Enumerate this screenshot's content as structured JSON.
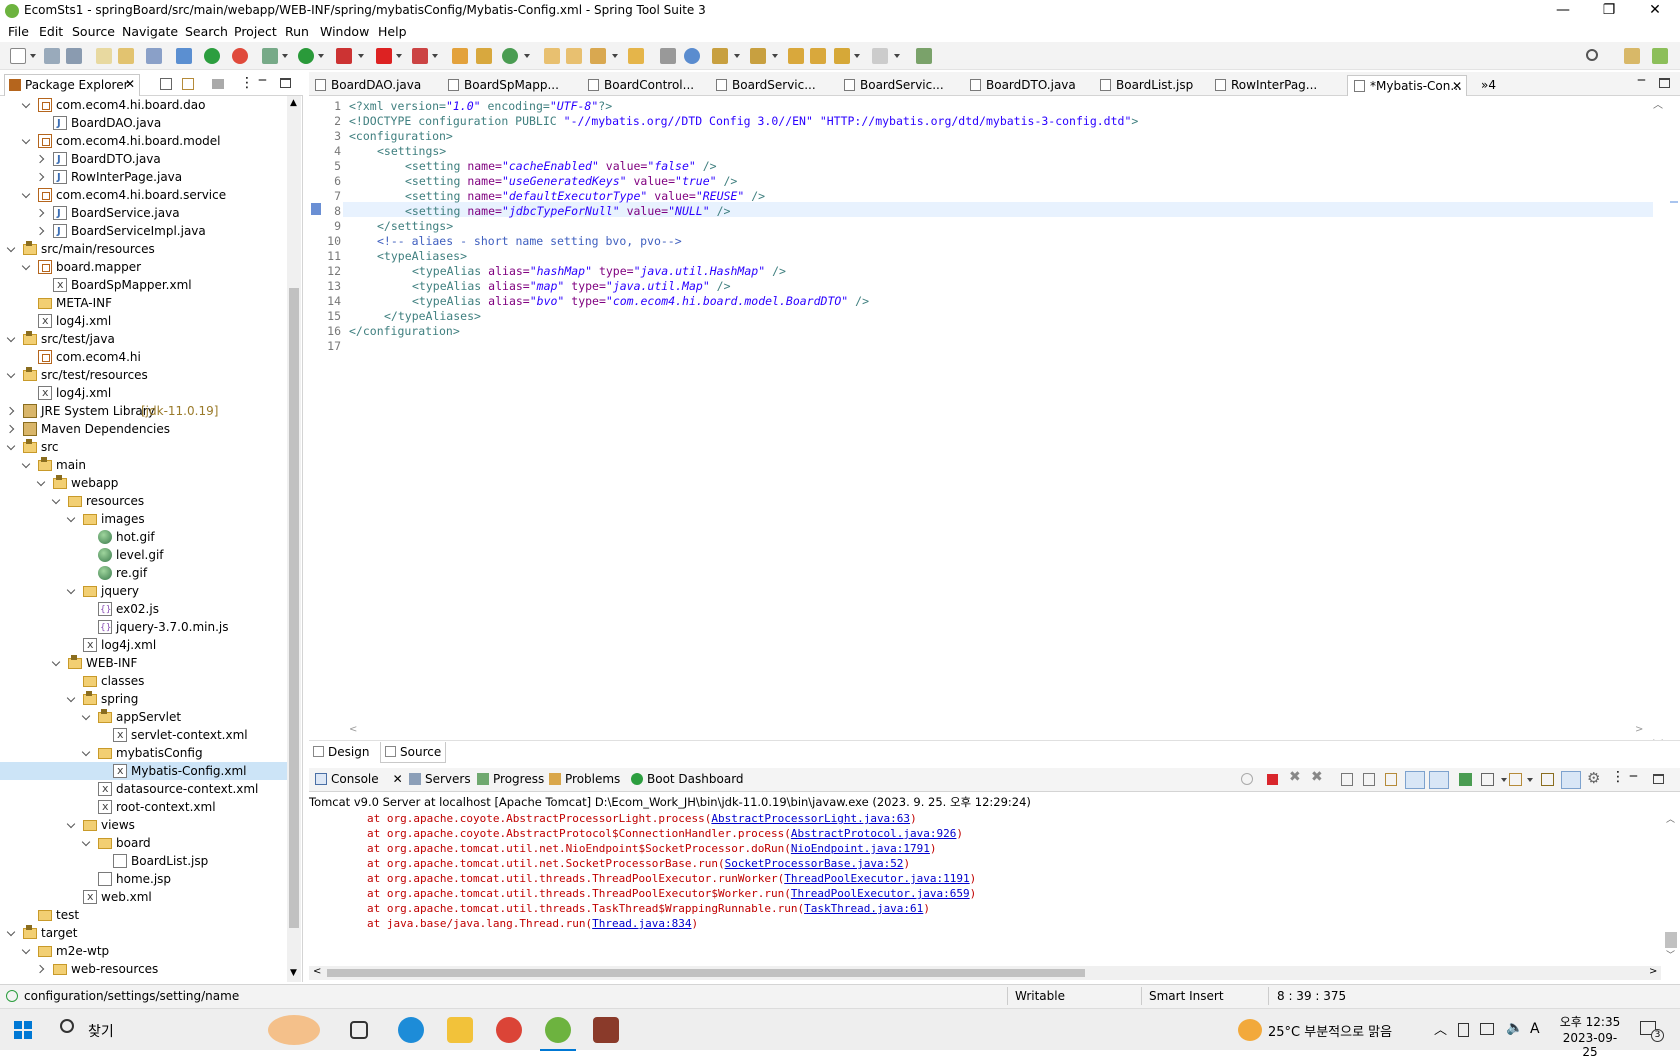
{
  "window": {
    "title": "EcomSts1 - springBoard/src/main/webapp/WEB-INF/spring/mybatisConfig/Mybatis-Config.xml - Spring Tool Suite 3",
    "minimize": "—",
    "maximize": "❐",
    "close": "✕"
  },
  "menu": [
    "File",
    "Edit",
    "Source",
    "Navigate",
    "Search",
    "Project",
    "Run",
    "Window",
    "Help"
  ],
  "explorer": {
    "tab_label": "Package Explorer",
    "tree": [
      {
        "label": "com.ecom4.hi.board.dao",
        "icon": "package-icon"
      },
      {
        "label": "BoardDAO.java",
        "icon": "java-file-icon"
      },
      {
        "label": "com.ecom4.hi.board.model",
        "icon": "package-icon"
      },
      {
        "label": "BoardDTO.java",
        "icon": "java-file-icon"
      },
      {
        "label": "RowInterPage.java",
        "icon": "java-file-icon"
      },
      {
        "label": "com.ecom4.hi.board.service",
        "icon": "package-icon"
      },
      {
        "label": "BoardService.java",
        "icon": "java-file-icon"
      },
      {
        "label": "BoardServiceImpl.java",
        "icon": "java-file-icon"
      },
      {
        "label": "src/main/resources",
        "icon": "source-folder-icon"
      },
      {
        "label": "board.mapper",
        "icon": "package-icon"
      },
      {
        "label": "BoardSpMapper.xml",
        "icon": "xml-file-icon"
      },
      {
        "label": "META-INF",
        "icon": "folder-icon"
      },
      {
        "label": "log4j.xml",
        "icon": "xml-file-icon"
      },
      {
        "label": "src/test/java",
        "icon": "source-folder-icon"
      },
      {
        "label": "com.ecom4.hi",
        "icon": "package-icon"
      },
      {
        "label": "src/test/resources",
        "icon": "source-folder-icon"
      },
      {
        "label": "log4j.xml",
        "icon": "xml-file-icon"
      },
      {
        "label": "JRE System Library",
        "suffix": "[jdk-11.0.19]",
        "icon": "library-icon"
      },
      {
        "label": "Maven Dependencies",
        "icon": "library-icon"
      },
      {
        "label": "src",
        "icon": "source-folder-icon"
      },
      {
        "label": "main",
        "icon": "source-folder-icon"
      },
      {
        "label": "webapp",
        "icon": "source-folder-icon"
      },
      {
        "label": "resources",
        "icon": "folder-icon"
      },
      {
        "label": "images",
        "icon": "folder-icon"
      },
      {
        "label": "hot.gif",
        "icon": "gif-file-icon"
      },
      {
        "label": "level.gif",
        "icon": "gif-file-icon"
      },
      {
        "label": "re.gif",
        "icon": "gif-file-icon"
      },
      {
        "label": "jquery",
        "icon": "folder-icon"
      },
      {
        "label": "ex02.js",
        "icon": "js-file-icon"
      },
      {
        "label": "jquery-3.7.0.min.js",
        "icon": "js-file-icon"
      },
      {
        "label": "log4j.xml",
        "icon": "xml-file-icon"
      },
      {
        "label": "WEB-INF",
        "icon": "source-folder-icon"
      },
      {
        "label": "classes",
        "icon": "folder-icon"
      },
      {
        "label": "spring",
        "icon": "source-folder-icon"
      },
      {
        "label": "appServlet",
        "icon": "source-folder-icon"
      },
      {
        "label": "servlet-context.xml",
        "icon": "xml-file-icon"
      },
      {
        "label": "mybatisConfig",
        "icon": "folder-icon"
      },
      {
        "label": "Mybatis-Config.xml",
        "icon": "xml-file-icon"
      },
      {
        "label": "datasource-context.xml",
        "icon": "xml-file-icon"
      },
      {
        "label": "root-context.xml",
        "icon": "xml-file-icon"
      },
      {
        "label": "views",
        "icon": "folder-icon"
      },
      {
        "label": "board",
        "icon": "folder-icon"
      },
      {
        "label": "BoardList.jsp",
        "icon": "jsp-file-icon"
      },
      {
        "label": "home.jsp",
        "icon": "jsp-file-icon"
      },
      {
        "label": "web.xml",
        "icon": "xml-file-icon"
      },
      {
        "label": "test",
        "icon": "folder-icon"
      },
      {
        "label": "target",
        "icon": "source-folder-icon"
      },
      {
        "label": "m2e-wtp",
        "icon": "folder-icon"
      },
      {
        "label": "web-resources",
        "icon": "folder-icon"
      }
    ]
  },
  "editor": {
    "tabs": [
      "BoardDAO.java",
      "BoardSpMapp...",
      "BoardControl...",
      "BoardServic...",
      "BoardServic...",
      "BoardDTO.java",
      "BoardList.jsp",
      "RowInterPag...",
      "*Mybatis-Con..."
    ],
    "overflow": "»4",
    "lines": [
      "1",
      "2",
      "3",
      "4",
      "5",
      "6",
      "7",
      "8",
      "9",
      "10",
      "11",
      "12",
      "13",
      "14",
      "15",
      "16",
      "17"
    ],
    "code": {
      "l1_a": "<?xml version=",
      "l1_b": "\"1.0\"",
      "l1_c": " encoding=",
      "l1_d": "\"UTF-8\"",
      "l1_e": "?>",
      "l2_a": "<!DOCTYPE configuration PUBLIC ",
      "l2_b": "\"-//mybatis.org//DTD Config 3.0//EN\" \"HTTP://mybatis.org/dtd/mybatis-3-config.dtd\"",
      "l2_c": ">",
      "l3": "<configuration>",
      "l4": "<settings>",
      "setting_tag": "<setting ",
      "name_attr": "name=",
      "value_attr": " value=",
      "close_empty": " />",
      "s1_name": "\"cacheEnabled\"",
      "s1_val": "\"false\"",
      "s2_name": "\"useGeneratedKeys\"",
      "s2_val": "\"true\"",
      "s3_name": "\"defaultExecutorType\"",
      "s3_val": "\"REUSE\"",
      "s4_name": "\"jdbcTypeForNull\"",
      "s4_val": "\"NULL\"",
      "l9": "</settings>",
      "l10": "<!-- aliaes - short name setting bvo, pvo-->",
      "l11": "<typeAliases>",
      "alias_tag": "<typeAlias ",
      "alias_attr": "alias=",
      "type_attr": " type=",
      "a1_alias": "\"hashMap\"",
      "a1_type": "\"java.util.HashMap\"",
      "a2_alias": "\"map\"",
      "a2_type": "\"java.util.Map\"",
      "a3_alias": "\"bvo\"",
      "a3_type": "\"com.ecom4.hi.board.model.BoardDTO\"",
      "l15": "</typeAliases>",
      "l16": "</configuration>"
    },
    "bottom_tabs": [
      "Design",
      "Source"
    ]
  },
  "console": {
    "tabs": [
      "Console",
      "Servers",
      "Progress",
      "Problems",
      "Boot Dashboard"
    ],
    "description": "Tomcat v9.0 Server at localhost [Apache Tomcat] D:\\Ecom_Work_JH\\bin\\jdk-11.0.19\\bin\\javaw.exe  (2023. 9. 25. 오후 12:29:24)",
    "trace": [
      {
        "text": "at org.apache.coyote.AbstractProcessorLight.process(",
        "link": "AbstractProcessorLight.java:63",
        "end": ")"
      },
      {
        "text": "at org.apache.coyote.AbstractProtocol$ConnectionHandler.process(",
        "link": "AbstractProtocol.java:926",
        "end": ")"
      },
      {
        "text": "at org.apache.tomcat.util.net.NioEndpoint$SocketProcessor.doRun(",
        "link": "NioEndpoint.java:1791",
        "end": ")"
      },
      {
        "text": "at org.apache.tomcat.util.net.SocketProcessorBase.run(",
        "link": "SocketProcessorBase.java:52",
        "end": ")"
      },
      {
        "text": "at org.apache.tomcat.util.threads.ThreadPoolExecutor.runWorker(",
        "link": "ThreadPoolExecutor.java:1191",
        "end": ")"
      },
      {
        "text": "at org.apache.tomcat.util.threads.ThreadPoolExecutor$Worker.run(",
        "link": "ThreadPoolExecutor.java:659",
        "end": ")"
      },
      {
        "text": "at org.apache.tomcat.util.threads.TaskThread$WrappingRunnable.run(",
        "link": "TaskThread.java:61",
        "end": ")"
      },
      {
        "text": "at java.base/java.lang.Thread.run(",
        "link": "Thread.java:834",
        "end": ")"
      }
    ]
  },
  "status": {
    "path": "configuration/settings/setting/name",
    "mode": "Writable",
    "insert": "Smart Insert",
    "position": "8 : 39 : 375"
  },
  "taskbar": {
    "search_label": "찾기",
    "weather": "25°C  부분적으로 맑음",
    "time": "오후 12:35",
    "date": "2023-09-25",
    "ime": "A",
    "notifications": "3"
  }
}
